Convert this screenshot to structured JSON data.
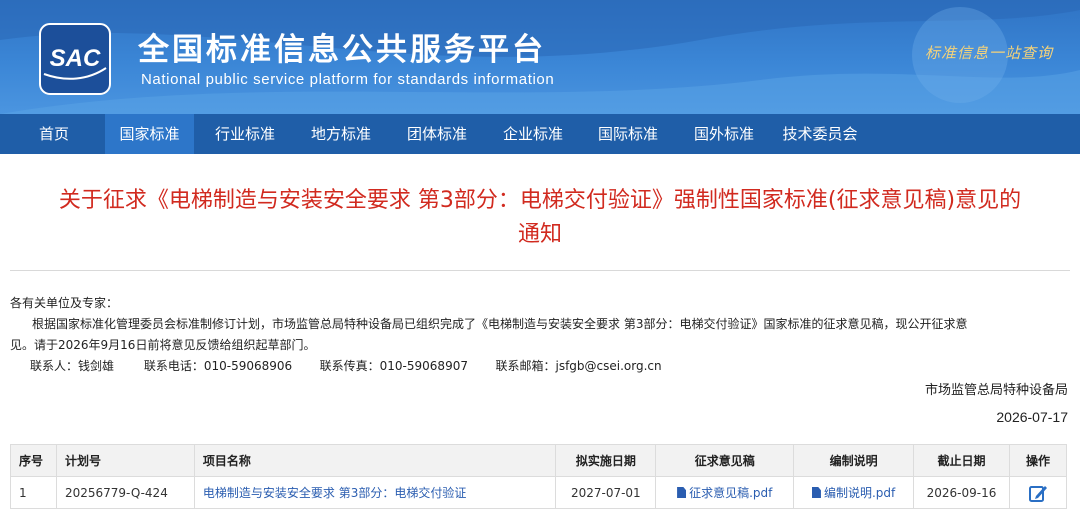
{
  "header": {
    "logo_text": "SAC",
    "title": "全国标准信息公共服务平台",
    "subtitle": "National public service platform  for standards information",
    "slogan": "标准信息一站查询"
  },
  "nav": {
    "items": [
      {
        "label": "首页"
      },
      {
        "label": "国家标准",
        "active": true
      },
      {
        "label": "行业标准"
      },
      {
        "label": "地方标准"
      },
      {
        "label": "团体标准"
      },
      {
        "label": "企业标准"
      },
      {
        "label": "国际标准"
      },
      {
        "label": "国外标准"
      },
      {
        "label": "技术委员会"
      }
    ]
  },
  "notice": {
    "title_line1": "关于征求《电梯制造与安装安全要求 第3部分：电梯交付验证》强制性国家标准(征求意见稿)意见的",
    "title_line2": "通知",
    "greeting": "各有关单位及专家：",
    "paragraph_line1": "根据国家标准化管理委员会标准制修订计划，市场监管总局特种设备局已组织完成了《电梯制造与安装安全要求 第3部分：电梯交付验证》国家标准的征求意见稿，现公开征求意",
    "paragraph_line2": "见。请于2026年9月16日前将意见反馈给组织起草部门。",
    "contact_person": "联系人：钱剑雄",
    "contact_phone": "联系电话：010-59068906",
    "contact_fax": "联系传真：010-59068907",
    "contact_email": "联系邮箱：jsfgb@csei.org.cn",
    "signature": "市场监管总局特种设备局",
    "date": "2026-07-17"
  },
  "table": {
    "headers": [
      "序号",
      "计划号",
      "项目名称",
      "拟实施日期",
      "征求意见稿",
      "编制说明",
      "截止日期",
      "操作"
    ],
    "rows": [
      {
        "index": "1",
        "plan_no": "20256779-Q-424",
        "project_name": "电梯制造与安装安全要求 第3部分：电梯交付验证",
        "impl_date": "2027-07-01",
        "draft_file": "征求意见稿.pdf",
        "explain_file": "编制说明.pdf",
        "deadline": "2026-09-16"
      }
    ]
  },
  "colors": {
    "banner_blue": "#3b86d6",
    "nav_blue": "#1f5ea8",
    "nav_active": "#2d76c9",
    "title_red": "#d12a1f",
    "link_blue": "#2a5db0"
  }
}
